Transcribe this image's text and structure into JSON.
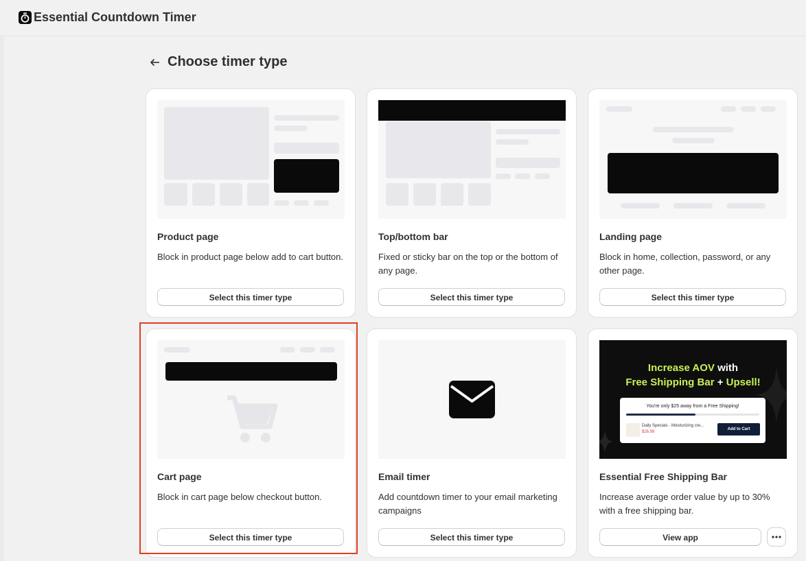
{
  "app": {
    "title": "Essential Countdown Timer",
    "icon": "stopwatch-icon"
  },
  "page": {
    "title": "Choose timer type",
    "back_icon": "arrow-left-icon"
  },
  "cards": [
    {
      "title": "Product page",
      "description": "Block in product page below add to cart button.",
      "button": "Select this timer type"
    },
    {
      "title": "Top/bottom bar",
      "description": "Fixed or sticky bar on the top or the bottom of any page.",
      "button": "Select this timer type"
    },
    {
      "title": "Landing page",
      "description": "Block in home, collection, password, or any other page.",
      "button": "Select this timer type"
    },
    {
      "title": "Cart page",
      "description": "Block in cart page below checkout button.",
      "button": "Select this timer type",
      "selected": true
    },
    {
      "title": "Email timer",
      "description": "Add countdown timer to your email marketing campaigns",
      "button": "Select this timer type"
    },
    {
      "title": "Essential Free Shipping Bar",
      "description": "Increase average order value by up to 30% with a free shipping bar.",
      "button": "View app",
      "more_icon": "ellipsis-icon"
    }
  ],
  "ad": {
    "headline_1a": "Increase AOV",
    "headline_1b": "with",
    "headline_2a": "Free Shipping Bar",
    "headline_2b": "+",
    "headline_2c": "Upsell!",
    "message": "You're only $25 away from a Free Shipping!",
    "progress": 0.52,
    "product": "Daily Specials - Moisturizing cre...",
    "price": "$26.99",
    "cta": "Add to Cart"
  },
  "colors": {
    "accent_highlight": "#e03d21",
    "ad_green": "#c8f055",
    "dark_block": "#0a0a0a"
  }
}
